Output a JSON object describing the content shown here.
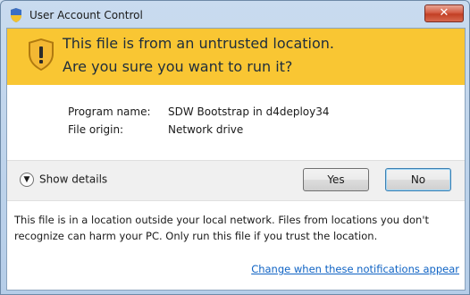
{
  "window": {
    "title": "User Account Control",
    "close_label": "✕"
  },
  "banner": {
    "line1": "This file is from an untrusted location.",
    "line2": "Are you sure you want to run it?",
    "icon": "warning-shield-icon",
    "color": "#f9c633"
  },
  "details": {
    "program_label": "Program name:",
    "program_value": "SDW Bootstrap in d4deploy34",
    "origin_label": "File origin:",
    "origin_value": "Network drive"
  },
  "actions": {
    "show_details_label": "Show details",
    "yes_label": "Yes",
    "no_label": "No"
  },
  "info": {
    "text": "This file is in a location outside your local network. Files from locations you don't recognize can harm your PC. Only run this file if you trust the location.",
    "link": "Change when these notifications appear"
  }
}
